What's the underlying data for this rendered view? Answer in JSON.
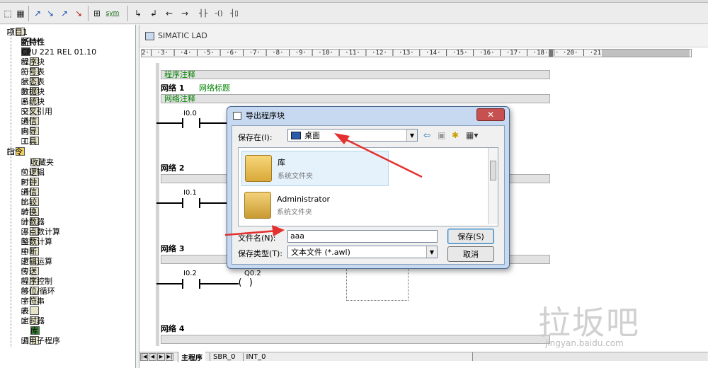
{
  "toolbar": {
    "buttons": [
      "⬚",
      "▦",
      "↗",
      "↘",
      "↗",
      "↘",
      "⊞",
      "sym",
      "↳",
      "↲",
      "←",
      "→",
      "┤├",
      "-()",
      "┤▯"
    ]
  },
  "tree": {
    "root": "项目1",
    "items": [
      {
        "label": "新特性",
        "bold": true,
        "indent": 2
      },
      {
        "label": "CPU 221 REL 01.10",
        "indent": 2
      },
      {
        "label": "程序块",
        "indent": 2
      },
      {
        "label": "符号表",
        "indent": 2
      },
      {
        "label": "状态表",
        "indent": 2
      },
      {
        "label": "数据块",
        "indent": 2
      },
      {
        "label": "系统块",
        "indent": 2
      },
      {
        "label": "交叉引用",
        "indent": 2
      },
      {
        "label": "通信",
        "indent": 2
      },
      {
        "label": "向导",
        "indent": 2
      },
      {
        "label": "工具",
        "indent": 2
      }
    ],
    "instr_root": "指令",
    "instr_items": [
      "收藏夹",
      "位逻辑",
      "时钟",
      "通信",
      "比较",
      "转换",
      "计数器",
      "浮点数计算",
      "整数计算",
      "中断",
      "逻辑运算",
      "传送",
      "程序控制",
      "移位/循环",
      "字符串",
      "表",
      "定时器",
      "库",
      "调用子程序"
    ]
  },
  "editor": {
    "title": "SIMATIC LAD",
    "ruler_left": "2·| ·3· | ·4· | ·5· | ·6· | ·7· | ·8· | ·9· | ·10· | ·11· | ·12· | ·13· | ·14· | ·15· | ·16· | ·17· | ·18· |",
    "ruler_right": "· ·20· | ·21· |",
    "program_comment": "程序注释",
    "networks": [
      {
        "label": "网络 1",
        "title": "网络标题",
        "comment": "网络注释",
        "contact": "I0.0"
      },
      {
        "label": "网络 2",
        "contact": "I0.1"
      },
      {
        "label": "网络 3",
        "contact": "I0.2",
        "coil": "Q0.2"
      },
      {
        "label": "网络 4"
      }
    ],
    "coil_symbol": "( )",
    "tabs": [
      "主程序",
      "SBR_0",
      "INT_0"
    ]
  },
  "dialog": {
    "title": "导出程序块",
    "close": "✕",
    "save_in_label": "保存在(I):",
    "save_in_value": "桌面",
    "files": [
      {
        "name": "库",
        "type": "系统文件夹"
      },
      {
        "name": "Administrator",
        "type": "系统文件夹"
      }
    ],
    "filename_label": "文件名(N):",
    "filename_value": "aaa",
    "filetype_label": "保存类型(T):",
    "filetype_value": "文本文件 (*.awl)",
    "save_button": "保存(S)",
    "cancel_button": "取消"
  },
  "watermark": {
    "text": "拉坂吧",
    "url": "jingyan.baidu.com"
  },
  "colors": {
    "annotation": "#e53030",
    "comment_green": "#008000",
    "dialog_frame": "#c6d9f1",
    "close_red": "#c75050"
  }
}
